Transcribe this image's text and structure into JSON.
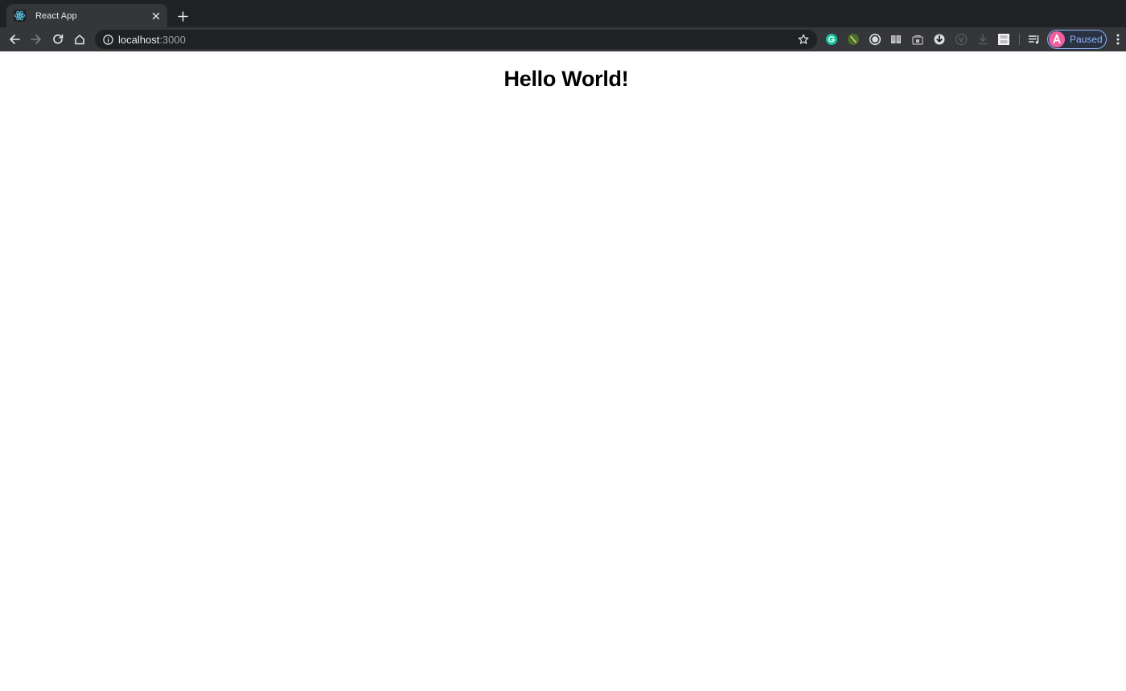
{
  "browser": {
    "tab": {
      "title": "React App",
      "favicon": "react-logo-icon"
    },
    "toolbar": {
      "url_host": "localhost",
      "url_port": ":3000",
      "profile_label": "Paused"
    },
    "extensions": [
      "grammarly-icon",
      "leaf-extension-icon",
      "circle-extension-icon",
      "reader-extension-icon",
      "lock-extension-icon",
      "download-arrow-icon",
      "v-extension-icon",
      "download-icon",
      "mm-pa-extension-icon",
      "reading-list-icon"
    ],
    "colors": {
      "frame": "#202124",
      "toolbar": "#35363a",
      "accent": "#8ab4f8"
    }
  },
  "page": {
    "heading": "Hello World!"
  }
}
